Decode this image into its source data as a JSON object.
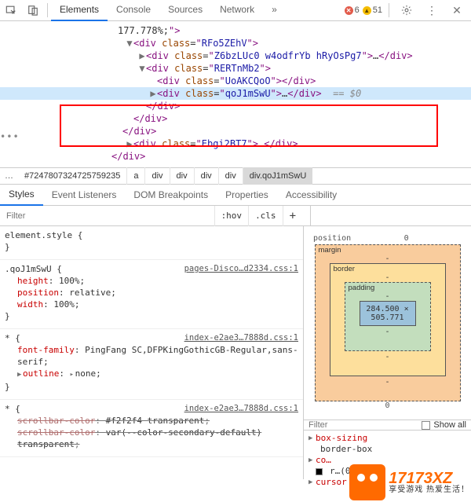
{
  "top": {
    "tabs": [
      "Elements",
      "Console",
      "Sources",
      "Network"
    ],
    "active_tab": 0,
    "errors": "6",
    "warnings": "51"
  },
  "dom": {
    "l0": "177.778%;",
    "d1": {
      "tag": "div",
      "cls": "RFo5ZEhV"
    },
    "d2": {
      "tag": "div",
      "cls": "Z6bzLUc0 w4odfrYb hRyOsPg7"
    },
    "d3": {
      "tag": "div",
      "cls": "RERTnMb2"
    },
    "d4": {
      "tag": "div",
      "cls": "UoAKCQoO"
    },
    "d5": {
      "tag": "div",
      "cls": "qoJ1mSwU"
    },
    "eq0": "== $0",
    "close_div": "div",
    "d6": {
      "tag": "div",
      "cls": "Ebgi2BT7"
    }
  },
  "crumbs": {
    "id": "#7247807324725759235",
    "items": [
      "a",
      "div",
      "div",
      "div",
      "div",
      "div.qoJ1mSwU"
    ]
  },
  "styles_tabs": [
    "Styles",
    "Event Listeners",
    "DOM Breakpoints",
    "Properties",
    "Accessibility"
  ],
  "styles_active_tab": 0,
  "filter": {
    "placeholder": "Filter",
    "hov": ":hov",
    "cls": ".cls"
  },
  "rules": {
    "elstyle_sel": "element.style {",
    "r1": {
      "link": "pages-Disco…d2334.css:1",
      "sel": ".qoJ1mSwU {",
      "p1n": "height",
      "p1v": "100%",
      "p2n": "position",
      "p2v": "relative",
      "p3n": "width",
      "p3v": "100%"
    },
    "r2": {
      "link": "index-e2ae3…7888d.css:1",
      "sel": "* {",
      "p1n": "font-family",
      "p1v": "PingFang SC,DFPKingGothicGB-Regular,sans-serif",
      "p2n": "outline",
      "p2v": "none"
    },
    "r3": {
      "link": "index-e2ae3…7888d.css:1",
      "sel": "* {",
      "p1n": "scrollbar-color",
      "p1v": "#f2f2f4 transparent",
      "p2n": "scrollbar-color",
      "p2v": "var(--color-secondary-default) transparent"
    }
  },
  "box": {
    "position_label": "position",
    "position_top": "0",
    "margin_label": "margin",
    "margin": "-",
    "border_label": "border",
    "border": "-",
    "padding_label": "padding",
    "padding": "-",
    "content": "284.500 × 505.771",
    "position_bottom": "0"
  },
  "rfilter": {
    "placeholder": "Filter",
    "showall": "Show all"
  },
  "computed": {
    "c1k": "box-sizing",
    "c1v": "border-box",
    "c2k": "co…",
    "c2v": "r…(0, 0)",
    "c3k": "cursor"
  },
  "watermark": {
    "brand": "17173XZ",
    "slogan": "享受游戏 热爱生活！"
  }
}
